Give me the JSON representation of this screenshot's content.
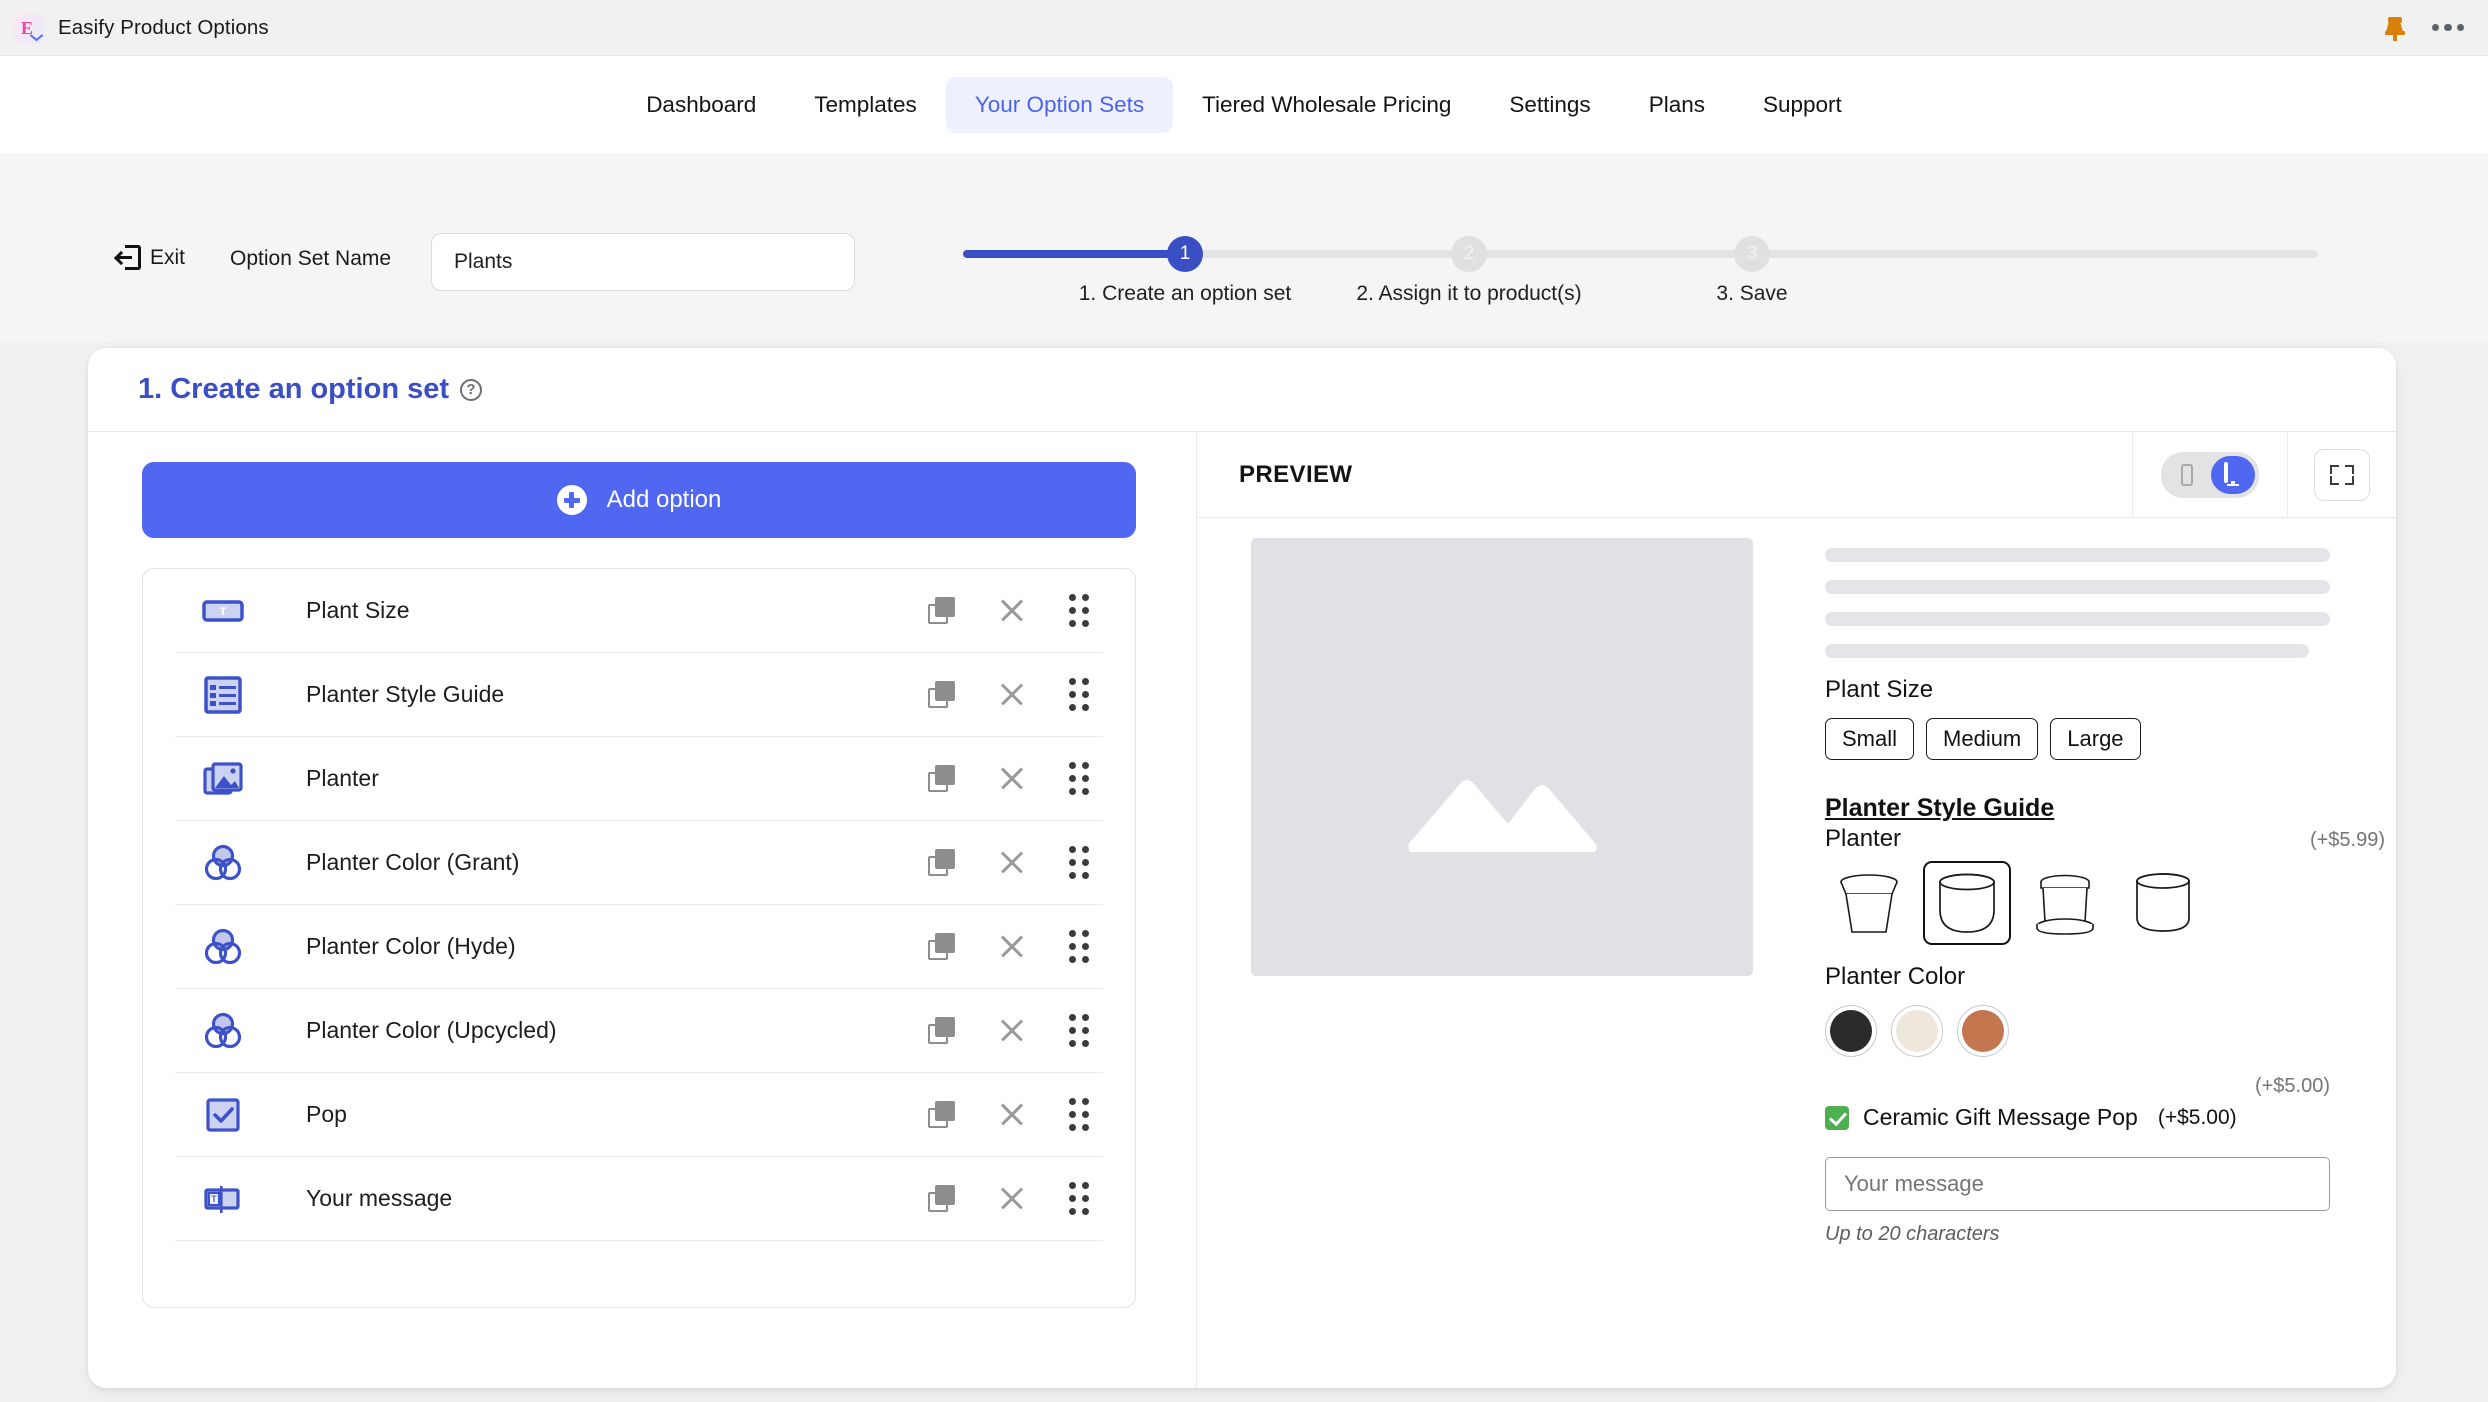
{
  "topbar": {
    "app_title": "Easify Product Options",
    "logo_glyph": "E",
    "pin_icon": "pin-icon",
    "menu_icon": "more-horizontal-icon"
  },
  "nav": {
    "tabs": [
      {
        "label": "Dashboard",
        "active": false
      },
      {
        "label": "Templates",
        "active": false
      },
      {
        "label": "Your Option Sets",
        "active": true
      },
      {
        "label": "Tiered Wholesale Pricing",
        "active": false
      },
      {
        "label": "Settings",
        "active": false
      },
      {
        "label": "Plans",
        "active": false
      },
      {
        "label": "Support",
        "active": false
      }
    ],
    "active_color": "#4a63f0",
    "active_bg": "#eef0fe"
  },
  "header": {
    "exit_label": "Exit",
    "option_set_name_label": "Option Set Name",
    "option_set_name_value": "Plants",
    "option_set_name_placeholder": "Option set name"
  },
  "stepper": {
    "steps": [
      {
        "number": "1",
        "label": "1. Create an option set",
        "state": "done"
      },
      {
        "number": "2",
        "label": "2. Assign it to product(s)",
        "state": "todo"
      },
      {
        "number": "3",
        "label": "3. Save",
        "state": "todo"
      }
    ],
    "fill_color": "#3a4fc4",
    "track_color": "#e4e4e6"
  },
  "card": {
    "title": "1. Create an option set",
    "help_icon": "question-mark-icon"
  },
  "left": {
    "add_option_label": "Add option",
    "add_option_color": "#5067f2",
    "options": [
      {
        "label": "Plant Size",
        "icon": "text-field-icon"
      },
      {
        "label": "Planter Style Guide",
        "icon": "list-block-icon"
      },
      {
        "label": "Planter",
        "icon": "image-swatch-icon"
      },
      {
        "label": "Planter Color (Grant)",
        "icon": "color-swatch-icon"
      },
      {
        "label": "Planter Color (Hyde)",
        "icon": "color-swatch-icon"
      },
      {
        "label": "Planter Color (Upcycled)",
        "icon": "color-swatch-icon"
      },
      {
        "label": "Pop",
        "icon": "checkbox-icon"
      },
      {
        "label": "Your message",
        "icon": "text-input-icon"
      }
    ],
    "row_actions": {
      "duplicate": "duplicate-icon",
      "remove": "close-icon",
      "drag": "drag-handle-icon"
    }
  },
  "preview": {
    "title": "PREVIEW",
    "device_mobile_icon": "mobile-icon",
    "device_desktop_icon": "desktop-icon",
    "device_selected": "desktop",
    "expand_icon": "fullscreen-icon",
    "image_placeholder_icon": "image-placeholder-icon",
    "skeleton_lines": 4,
    "plant_size": {
      "label": "Plant Size",
      "options": [
        "Small",
        "Medium",
        "Large"
      ]
    },
    "style_guide": {
      "link_label": "Planter Style Guide",
      "planter_label": "Planter",
      "price": "(+$5.99)",
      "swatches": [
        {
          "shape": "tapered-pot",
          "selected": false
        },
        {
          "shape": "round-bowl-pot",
          "selected": true
        },
        {
          "shape": "saucer-pot",
          "selected": false
        },
        {
          "shape": "cylinder-pot",
          "selected": false
        }
      ]
    },
    "planter_color": {
      "label": "Planter Color",
      "swatches": [
        {
          "name": "black",
          "hex": "#2b2b2b"
        },
        {
          "name": "cream",
          "hex": "#efe7db"
        },
        {
          "name": "terracotta",
          "hex": "#c4764f"
        }
      ]
    },
    "pop": {
      "price_above": "(+$5.00)",
      "checked": true,
      "label": "Ceramic Gift Message Pop",
      "price": "(+$5.00)",
      "check_color": "#4caf50"
    },
    "message": {
      "placeholder": "Your message",
      "value": "",
      "helper": "Up to 20 characters"
    }
  }
}
